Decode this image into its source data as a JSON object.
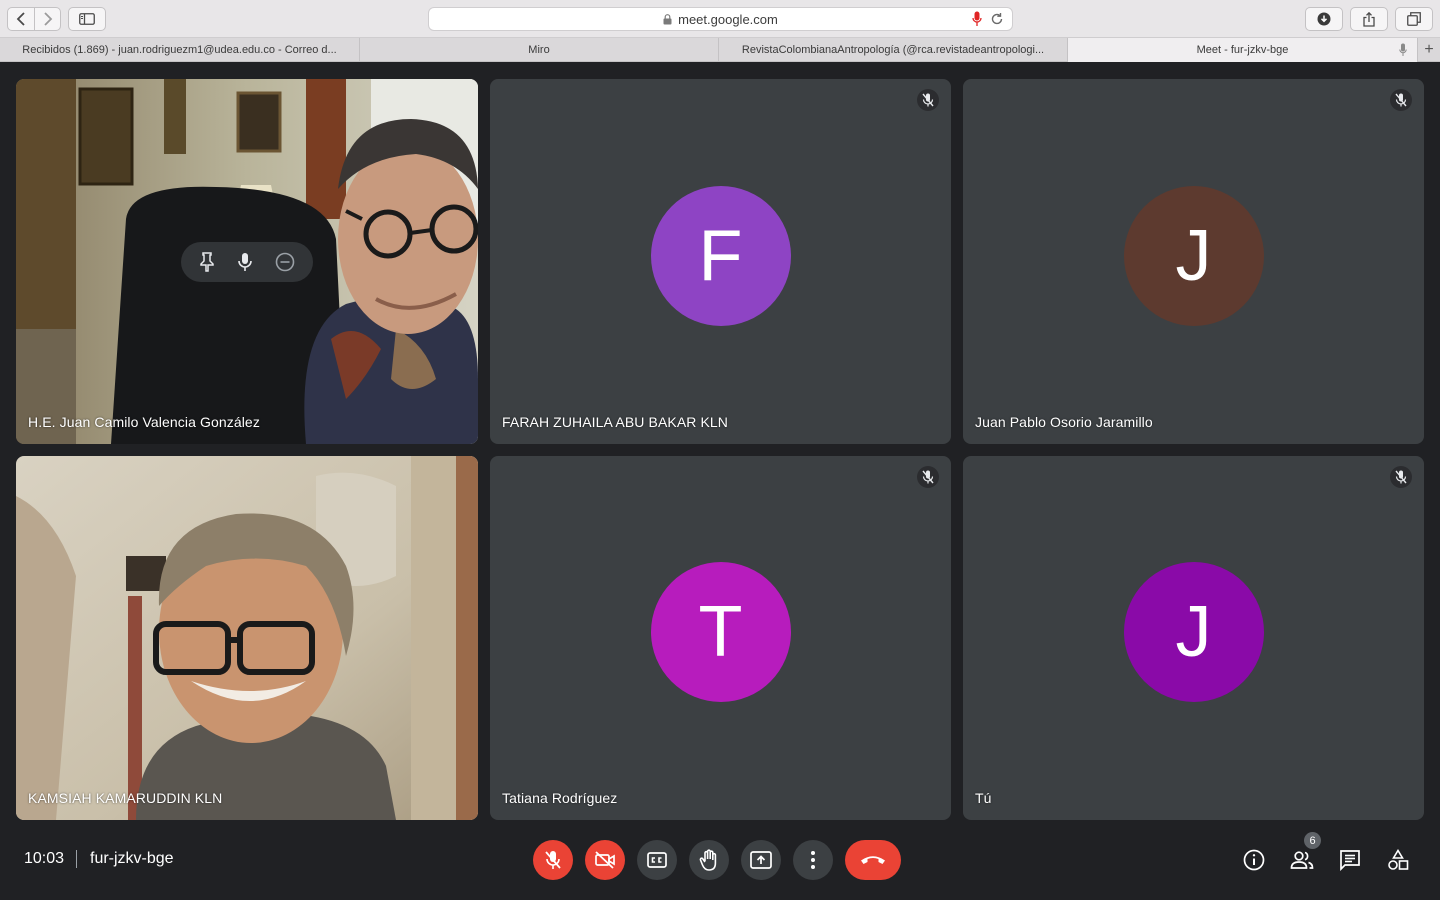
{
  "browser": {
    "url": "meet.google.com",
    "tabs": [
      {
        "label": "Recibidos (1.869) - juan.rodriguezm1@udea.edu.co - Correo d..."
      },
      {
        "label": "Miro"
      },
      {
        "label": "RevistaColombianaAntropología (@rca.revistadeantropologi..."
      },
      {
        "label": "Meet - fur-jzkv-bge"
      }
    ],
    "new_tab": "+"
  },
  "participants": [
    {
      "name": "H.E. Juan Camilo Valencia González",
      "type": "video"
    },
    {
      "name": "FARAH ZUHAILA ABU BAKAR KLN",
      "initial": "F",
      "color": "#8e44c4",
      "muted": true
    },
    {
      "name": "Juan Pablo Osorio Jaramillo",
      "initial": "J",
      "color": "#5d3a2f",
      "muted": true
    },
    {
      "name": "KAMSIAH KAMARUDDIN KLN",
      "type": "video"
    },
    {
      "name": "Tatiana Rodríguez",
      "initial": "T",
      "color": "#b71cbd",
      "muted": true
    },
    {
      "name": "Tú",
      "initial": "J",
      "color": "#8a0aa8",
      "muted": true
    }
  ],
  "meeting": {
    "time": "10:03",
    "code": "fur-jzkv-bge",
    "participant_count": "6"
  },
  "colors": {
    "background": "#202124",
    "tile": "#3c4043",
    "danger": "#ea4335"
  },
  "icons": [
    "mic-off-icon",
    "camera-off-icon",
    "captions-icon",
    "raise-hand-icon",
    "present-icon",
    "more-icon",
    "end-call-icon",
    "info-icon",
    "people-icon",
    "chat-icon",
    "activities-icon"
  ]
}
